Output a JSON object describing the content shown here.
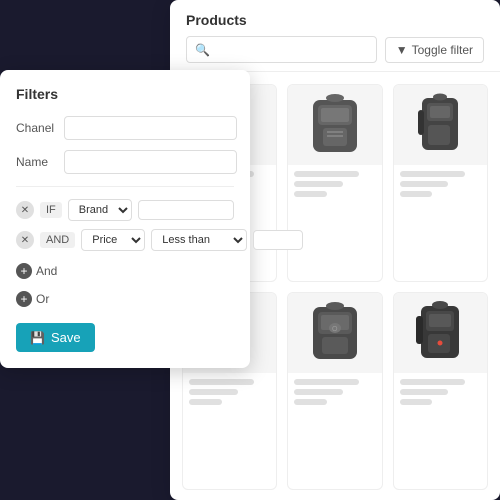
{
  "products_panel": {
    "title": "Products",
    "search_placeholder": "",
    "toggle_filter_label": "Toggle filter",
    "filter_icon": "▼"
  },
  "filters_panel": {
    "title": "Filters",
    "fields": [
      {
        "label": "Chanel",
        "value": ""
      },
      {
        "label": "Name",
        "value": ""
      }
    ],
    "conditions": [
      {
        "id": 1,
        "connector": "IF",
        "field": "Brand",
        "operator": "",
        "value": ""
      },
      {
        "id": 2,
        "connector": "AND",
        "field": "Price",
        "operator": "Less than",
        "value": ""
      }
    ],
    "add_condition_label": "And",
    "add_group_label": "Or",
    "save_label": "Save"
  },
  "products": [
    {
      "id": 1,
      "type": "backpack-dark"
    },
    {
      "id": 2,
      "type": "backpack-gray"
    },
    {
      "id": 3,
      "type": "backpack-side"
    },
    {
      "id": 4,
      "type": "backpack-dark"
    },
    {
      "id": 5,
      "type": "backpack-gray"
    },
    {
      "id": 6,
      "type": "backpack-side"
    }
  ]
}
